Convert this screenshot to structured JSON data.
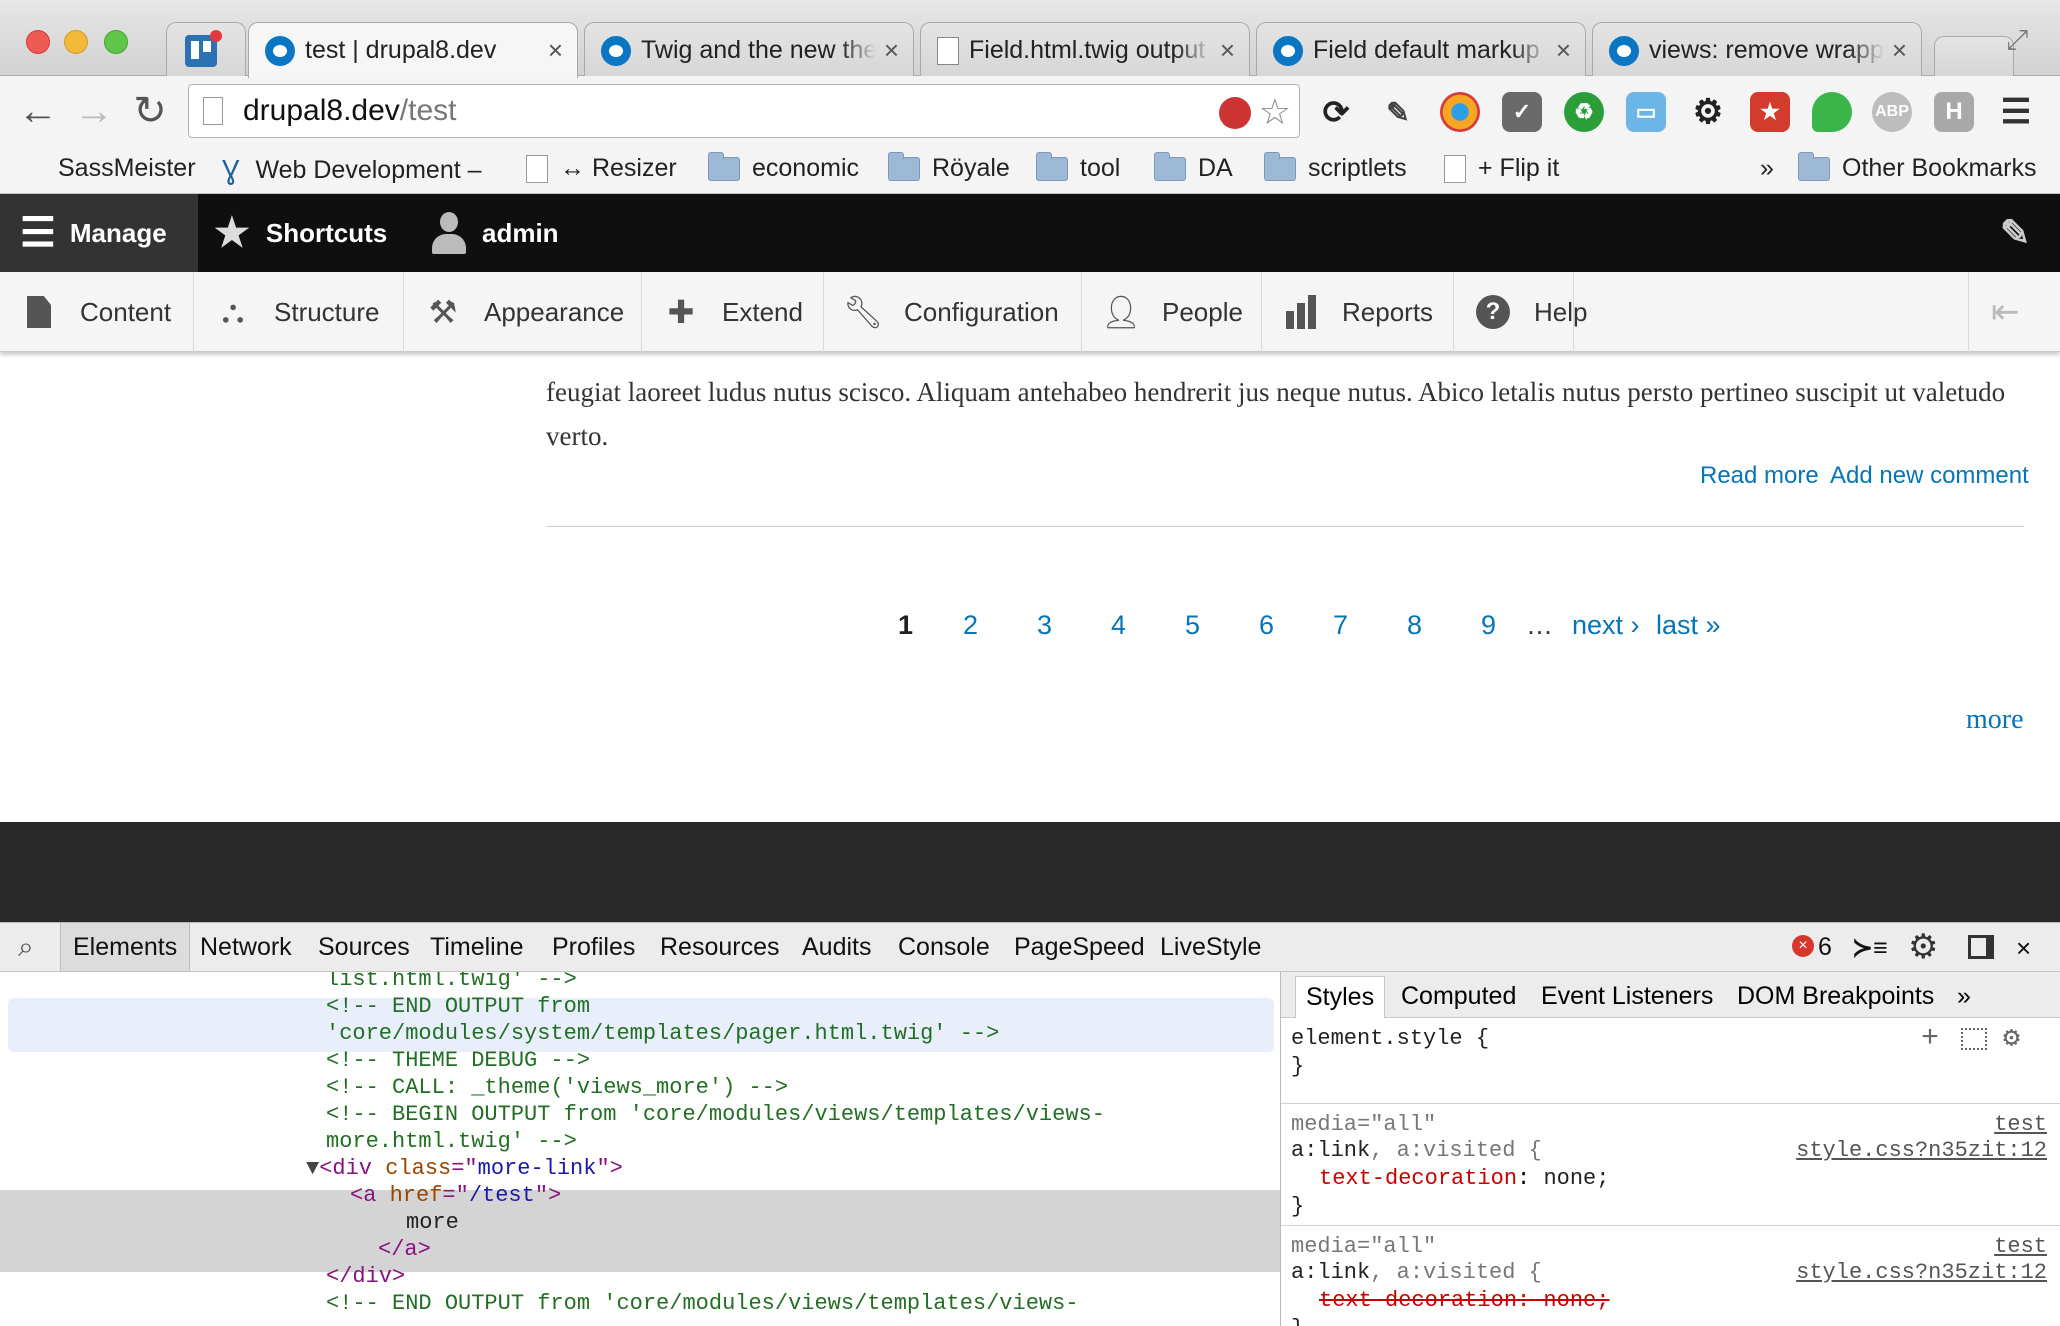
{
  "browser": {
    "tabs": [
      {
        "label": "test | drupal8.dev",
        "close": "×"
      },
      {
        "label": "Twig and the new theme",
        "close": "×"
      },
      {
        "label": "Field.html.twig output",
        "close": "×"
      },
      {
        "label": "Field default markup",
        "close": "×"
      },
      {
        "label": "views: remove wrapper",
        "close": "×"
      }
    ],
    "url_host": "drupal8.dev",
    "url_path": "/test",
    "bookmarks": [
      "SassMeister",
      "Web Development –",
      "↔ Resizer",
      "economic",
      "Röyale",
      "tool",
      "DA",
      "scriptlets",
      "+ Flip it",
      "»",
      "Other Bookmarks"
    ],
    "extension_letters": {
      "abp": "ABP",
      "h": "H"
    }
  },
  "admin": {
    "manage": "Manage",
    "shortcuts": "Shortcuts",
    "user": "admin",
    "tray": [
      "Content",
      "Structure",
      "Appearance",
      "Extend",
      "Configuration",
      "People",
      "Reports",
      "Help"
    ]
  },
  "page": {
    "paragraph": "feugiat laoreet ludus nutus scisco. Aliquam antehabeo hendrerit jus neque nutus. Abico letalis nutus persto pertineo suscipit ut valetudo verto.",
    "read_more": "Read more",
    "add_comment": "Add new comment",
    "pager": {
      "current": "1",
      "pages": [
        "2",
        "3",
        "4",
        "5",
        "6",
        "7",
        "8",
        "9"
      ],
      "ellipsis": "…",
      "next": "next ›",
      "last": "last »"
    },
    "more": "more"
  },
  "devtools": {
    "tabs": [
      "Elements",
      "Network",
      "Sources",
      "Timeline",
      "Profiles",
      "Resources",
      "Audits",
      "Console",
      "PageSpeed",
      "LiveStyle"
    ],
    "error_count": "6",
    "dom_lines": [
      "list.html.twig' -->",
      "<!-- END OUTPUT from",
      "'core/modules/system/templates/pager.html.twig' -->",
      "<!-- THEME DEBUG -->",
      "<!-- CALL: _theme('views_more') -->",
      "<!-- BEGIN OUTPUT from 'core/modules/views/templates/views-",
      "more.html.twig' -->",
      "<!-- END OUTPUT from 'core/modules/views/templates/views-"
    ],
    "dom_div_class": "more-link",
    "dom_href": "/test",
    "dom_more": "more",
    "styles_tabs": [
      "Styles",
      "Computed",
      "Event Listeners",
      "DOM Breakpoints",
      "»"
    ],
    "element_style": "element.style {",
    "close_brace": "}",
    "media": "media=\"all\"",
    "selector_a": "a:link",
    "selector_b": ", a:visited {",
    "prop": "text-decoration",
    "val": "none;",
    "strike": "text-decoration: none;",
    "source_name": "test",
    "source_file": "style.css?n35zit:12"
  }
}
